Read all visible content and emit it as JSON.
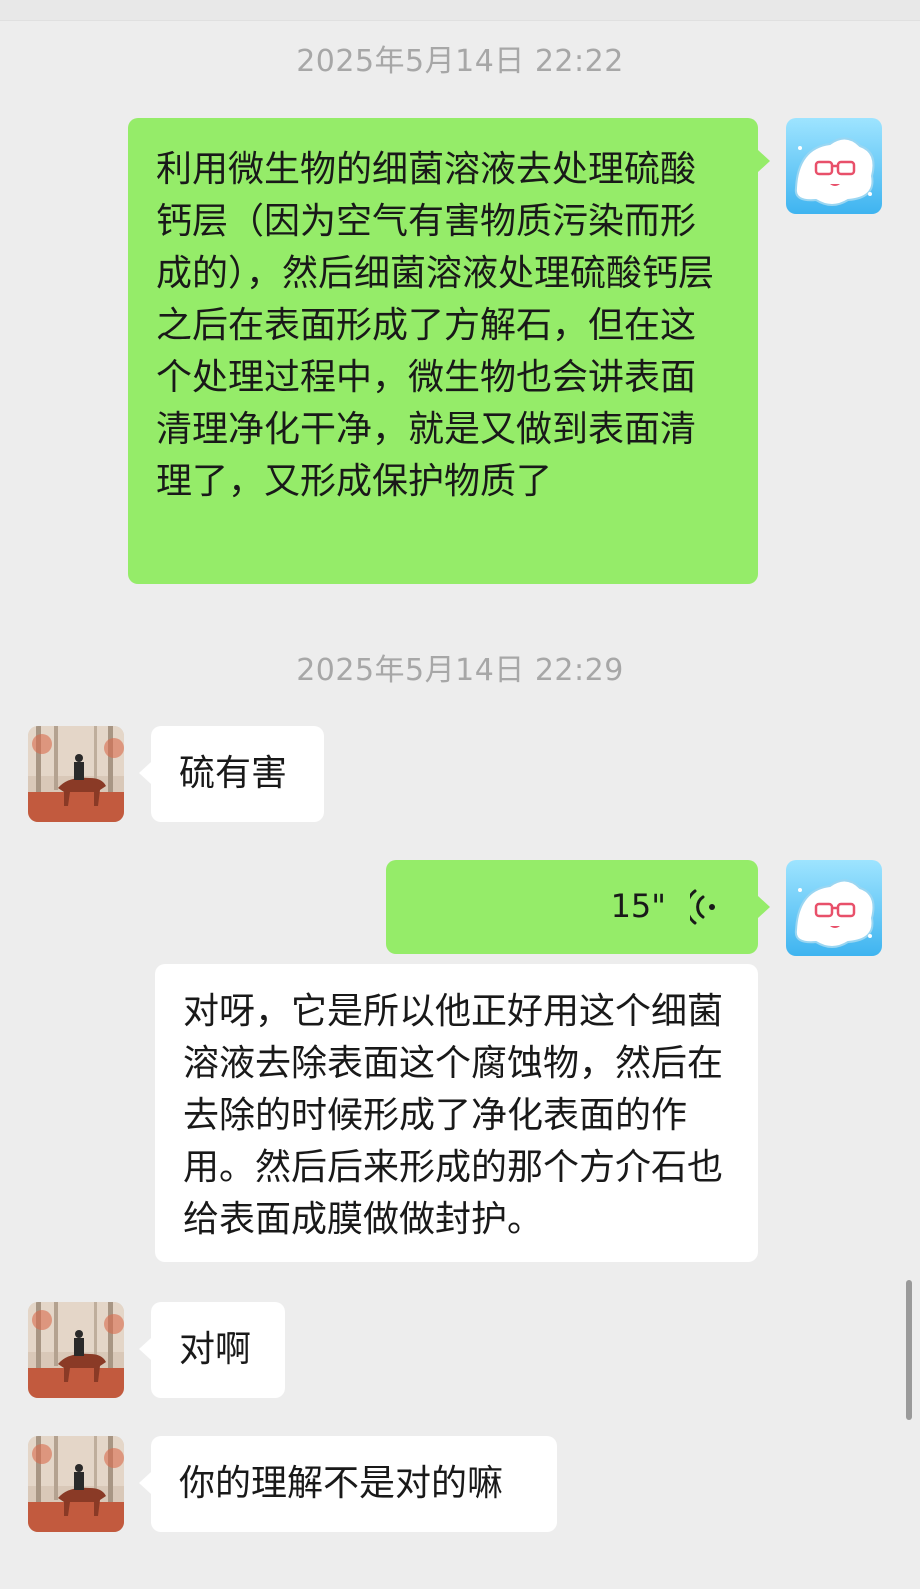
{
  "chat": {
    "timestamps": [
      "2025年5月14日 22:22",
      "2025年5月14日 22:29"
    ],
    "messages": [
      {
        "side": "right",
        "text": "利用微生物的细菌溶液去处理硫酸钙层（因为空气有害物质污染而形成的），然后细菌溶液处理硫酸钙层之后在表面形成了方解石，但在这个处理过程中，微生物也会讲表面清理净化干净，就是又做到表面清理了，又形成保护物质了"
      },
      {
        "side": "left",
        "text": "硫有害"
      },
      {
        "side": "right",
        "type": "voice",
        "duration": "15\"",
        "icon": "voice-wave-icon",
        "transcript": "对呀，它是所以他正好用这个细菌溶液去除表面这个腐蚀物，然后在去除的时候形成了净化表面的作用。然后后来形成的那个方介石也给表面成膜做做封护。"
      },
      {
        "side": "left",
        "text": "对啊"
      },
      {
        "side": "left",
        "text": "你的理解不是对的嘛"
      }
    ]
  },
  "colors": {
    "background": "#ededed",
    "sent_bubble": "#95ec69",
    "received_bubble": "#ffffff",
    "timestamp_text": "#a7a7a7"
  }
}
